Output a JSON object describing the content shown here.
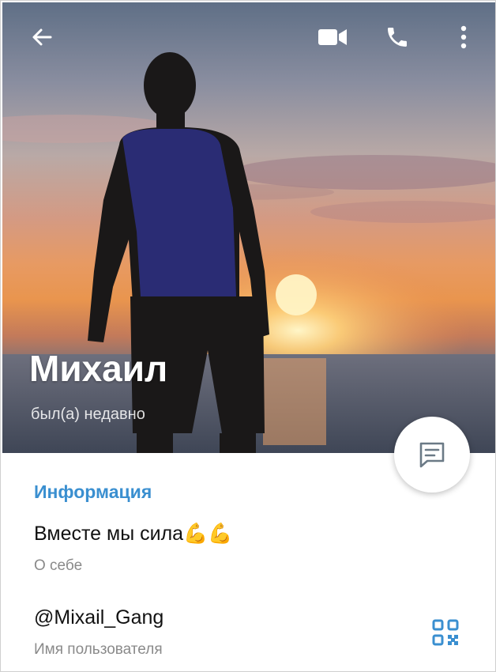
{
  "header": {
    "back_icon": "arrow-left-icon",
    "video_icon": "videocam-icon",
    "call_icon": "phone-icon",
    "more_icon": "more-vertical-icon"
  },
  "profile": {
    "name": "Михаил",
    "status": "был(а) недавно"
  },
  "info": {
    "section_title": "Информация",
    "bio": "Вместе мы сила💪💪",
    "bio_label": "О себе",
    "username": "@Mixail_Gang",
    "username_label": "Имя пользователя"
  },
  "colors": {
    "accent": "#3a8fd0",
    "text": "#111111",
    "secondary_text": "#8a8a8a"
  },
  "icons": {
    "fab": "message-icon",
    "qr": "qr-code-icon"
  }
}
